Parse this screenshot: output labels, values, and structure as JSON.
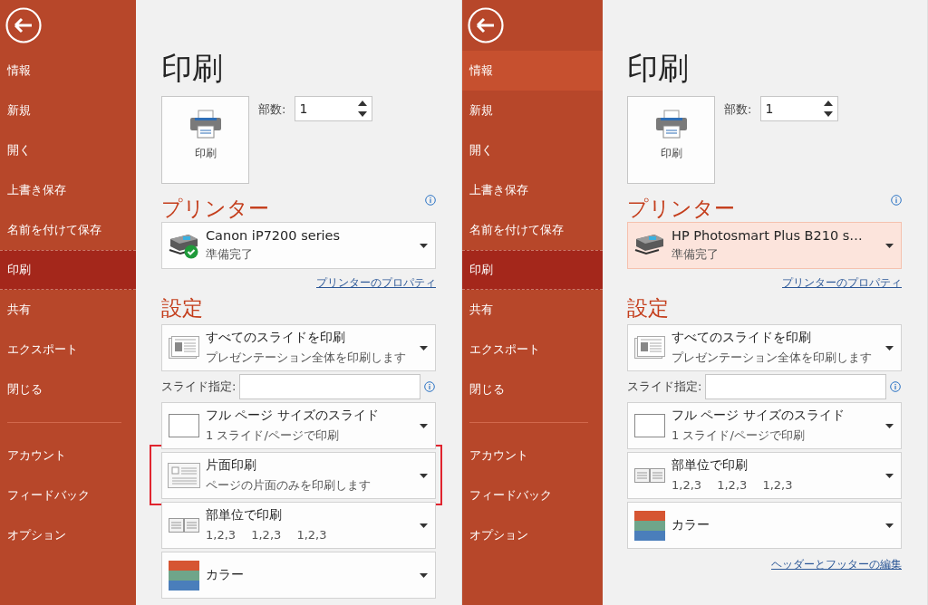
{
  "panes": [
    {
      "sidebar": {
        "groups": [
          [
            {
              "label": "情報",
              "selected": false,
              "hovered": false
            },
            {
              "label": "新規",
              "selected": false,
              "hovered": false
            },
            {
              "label": "開く",
              "selected": false,
              "hovered": false
            },
            {
              "label": "上書き保存",
              "selected": false,
              "hovered": false
            },
            {
              "label": "名前を付けて保存",
              "selected": false,
              "hovered": false
            },
            {
              "label": "印刷",
              "selected": true,
              "hovered": false
            },
            {
              "label": "共有",
              "selected": false,
              "hovered": false
            },
            {
              "label": "エクスポート",
              "selected": false,
              "hovered": false
            },
            {
              "label": "閉じる",
              "selected": false,
              "hovered": false
            }
          ],
          [
            {
              "label": "アカウント",
              "selected": false,
              "hovered": false
            },
            {
              "label": "フィードバック",
              "selected": false,
              "hovered": false
            },
            {
              "label": "オプション",
              "selected": false,
              "hovered": false
            }
          ]
        ]
      },
      "main": {
        "title": "印刷",
        "print_button": "印刷",
        "copies": {
          "label": "部数:",
          "value": "1"
        },
        "printer": {
          "heading": "プリンター",
          "name": "Canon iP7200 series",
          "status": "準備完了",
          "ready_badge": true,
          "highlighted": false,
          "link": "プリンターのプロパティ"
        },
        "settings": {
          "heading": "設定",
          "items": [
            {
              "kind": "all-slides",
              "title": "すべてのスライドを印刷",
              "subtitle": "プレゼンテーション全体を印刷します",
              "flagged": false
            },
            {
              "kind": "range",
              "label": "スライド指定:"
            },
            {
              "kind": "full-page",
              "title": "フル ページ サイズのスライド",
              "subtitle": "1 スライド/ページで印刷",
              "flagged": false
            },
            {
              "kind": "one-sided",
              "title": "片面印刷",
              "subtitle": "ページの片面のみを印刷します",
              "flagged": true
            },
            {
              "kind": "collated",
              "title": "部単位で印刷",
              "subtitle": "1,2,3　 1,2,3　 1,2,3",
              "flagged": false
            },
            {
              "kind": "color",
              "title": "カラー",
              "flagged": false
            }
          ]
        }
      }
    },
    {
      "sidebar": {
        "groups": [
          [
            {
              "label": "情報",
              "selected": false,
              "hovered": true
            },
            {
              "label": "新規",
              "selected": false,
              "hovered": false
            },
            {
              "label": "開く",
              "selected": false,
              "hovered": false
            },
            {
              "label": "上書き保存",
              "selected": false,
              "hovered": false
            },
            {
              "label": "名前を付けて保存",
              "selected": false,
              "hovered": false
            },
            {
              "label": "印刷",
              "selected": true,
              "hovered": false
            },
            {
              "label": "共有",
              "selected": false,
              "hovered": false
            },
            {
              "label": "エクスポート",
              "selected": false,
              "hovered": false
            },
            {
              "label": "閉じる",
              "selected": false,
              "hovered": false
            }
          ],
          [
            {
              "label": "アカウント",
              "selected": false,
              "hovered": false
            },
            {
              "label": "フィードバック",
              "selected": false,
              "hovered": false
            },
            {
              "label": "オプション",
              "selected": false,
              "hovered": false
            }
          ]
        ]
      },
      "main": {
        "title": "印刷",
        "print_button": "印刷",
        "copies": {
          "label": "部数:",
          "value": "1"
        },
        "printer": {
          "heading": "プリンター",
          "name": "HP Photosmart Plus B210 s…",
          "status": "準備完了",
          "ready_badge": false,
          "highlighted": true,
          "link": "プリンターのプロパティ"
        },
        "settings": {
          "heading": "設定",
          "items": [
            {
              "kind": "all-slides",
              "title": "すべてのスライドを印刷",
              "subtitle": "プレゼンテーション全体を印刷します",
              "flagged": false
            },
            {
              "kind": "range",
              "label": "スライド指定:"
            },
            {
              "kind": "full-page",
              "title": "フル ページ サイズのスライド",
              "subtitle": "1 スライド/ページで印刷",
              "flagged": false
            },
            {
              "kind": "collated",
              "title": "部単位で印刷",
              "subtitle": "1,2,3　 1,2,3　 1,2,3",
              "flagged": false
            },
            {
              "kind": "color",
              "title": "カラー",
              "flagged": false
            }
          ]
        },
        "footer_link": "ヘッダーとフッターの編集"
      }
    }
  ]
}
